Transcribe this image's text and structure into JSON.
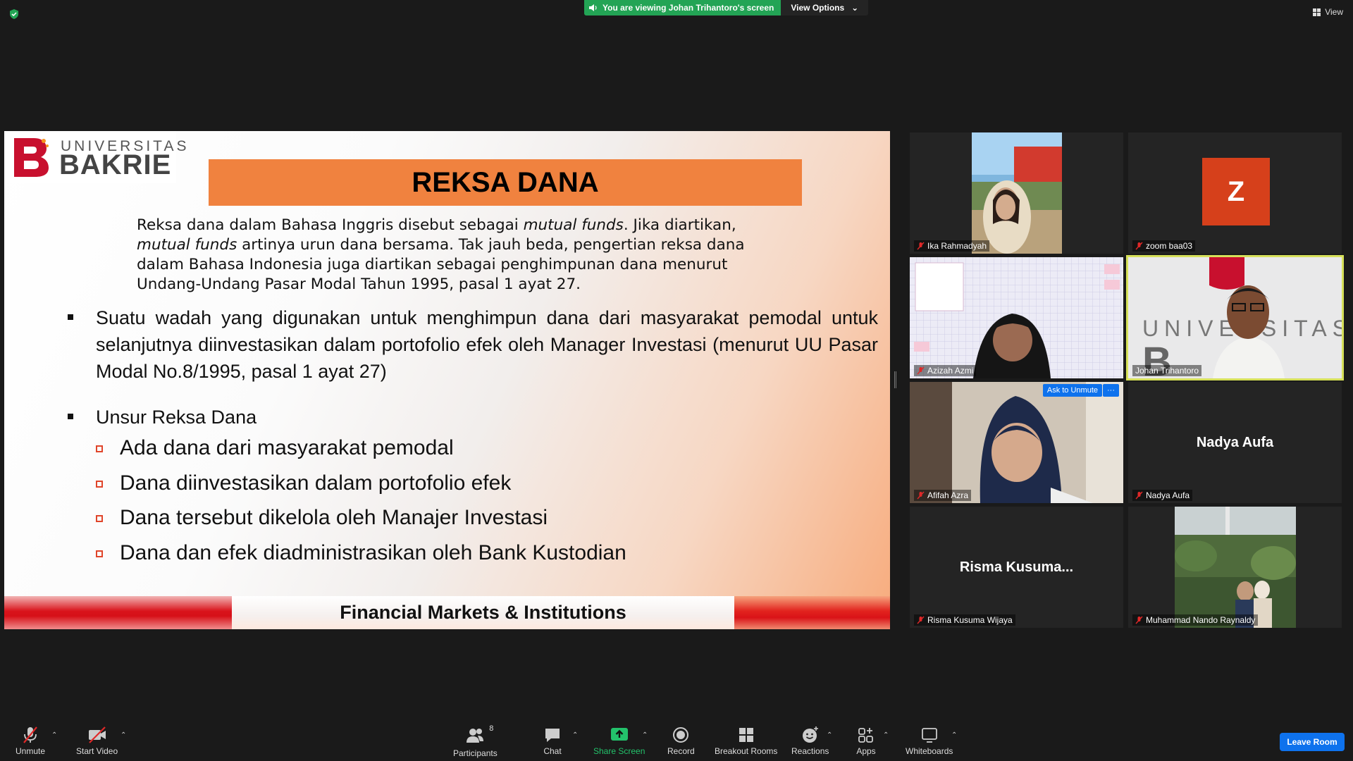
{
  "top_bar": {
    "viewing_banner": "You are viewing Johan Trihantoro's screen",
    "view_options": "View Options",
    "view_label": "View"
  },
  "slide": {
    "logo_line1": "UNIVERSITAS",
    "logo_line2": "BAKRIE",
    "title": "REKSA DANA",
    "intro": {
      "p1": "Reksa dana dalam Bahasa Inggris disebut sebagai ",
      "i1": "mutual funds",
      "p2": ". Jika diartikan, ",
      "i2": "mutual funds",
      "p3": " artinya urun dana bersama. Tak jauh beda, pengertian reksa dana dalam Bahasa Indonesia juga diartikan sebagai penghimpunan dana menurut Undang-Undang Pasar Modal Tahun 1995, pasal 1 ayat 27."
    },
    "bullet1": "Suatu wadah yang digunakan untuk menghimpun dana dari  masyarakat pemodal untuk selanjutnya diinvestasikan dalam  portofolio efek oleh Manager Investasi (menurut UU Pasar  Modal No.8/1995, pasal 1 ayat 27)",
    "bullet2": "Unsur Reksa Dana",
    "sub_items": [
      "Ada dana dari masyarakat pemodal",
      "Dana diinvestasikan dalam portofolio efek",
      "Dana tersebut dikelola oleh Manajer Investasi",
      "Dana dan efek diadministrasikan oleh Bank Kustodian"
    ],
    "footer": "Financial Markets & Institutions"
  },
  "participants": [
    {
      "name": "Ika Rahmadyah",
      "display": "video"
    },
    {
      "name": "zoom baa03",
      "display": "avatar",
      "initial": "Z"
    },
    {
      "name": "Azizah Azmi",
      "display": "video"
    },
    {
      "name": "Johan Trihantoro",
      "display": "video",
      "active": true
    },
    {
      "name": "Afifah Azra",
      "display": "video",
      "ask_unmute": "Ask to Unmute",
      "more": "···"
    },
    {
      "name": "Nadya Aufa",
      "display": "name",
      "big_name": "Nadya Aufa"
    },
    {
      "name": "Risma Kusuma Wijaya",
      "display": "name",
      "big_name": "Risma  Kusuma..."
    },
    {
      "name": "Muhammad Nando Raynaldy",
      "display": "video"
    }
  ],
  "toolbar": {
    "unmute": "Unmute",
    "start_video": "Start Video",
    "participants": "Participants",
    "participants_count": "8",
    "chat": "Chat",
    "share_screen": "Share Screen",
    "record": "Record",
    "breakout_rooms": "Breakout Rooms",
    "reactions": "Reactions",
    "apps": "Apps",
    "whiteboards": "Whiteboards",
    "leave_room": "Leave Room"
  },
  "colors": {
    "accent_green": "#23a455",
    "title_orange": "#f0823f",
    "zoom_blue": "#0e72ed",
    "avatar_orange": "#d6401b",
    "active_border": "#d6e05a"
  }
}
